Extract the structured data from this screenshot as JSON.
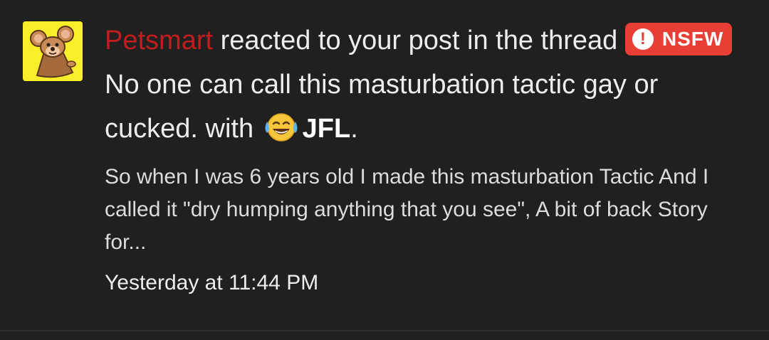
{
  "notification": {
    "user": "Petsmart",
    "action_text": " reacted to your post in the thread ",
    "prefix_badge": "NSFW",
    "prefix_icon": "exclamation-icon",
    "thread_title": "No one can call this masturbation tactic gay or cucked.",
    "with_text": " with ",
    "reaction_icon": "laughing-crying-emoji-icon",
    "reaction_label": "JFL",
    "period": ".",
    "snippet": "So when I was 6 years old I made this masturbation Tactic And I called it \"dry humping anything that you see\", A bit of back Story for...",
    "timestamp": "Yesterday at 11:44 PM"
  },
  "colors": {
    "background": "#202021",
    "username": "#c21d1d",
    "badge": "#e93e35",
    "text": "#ededed"
  }
}
